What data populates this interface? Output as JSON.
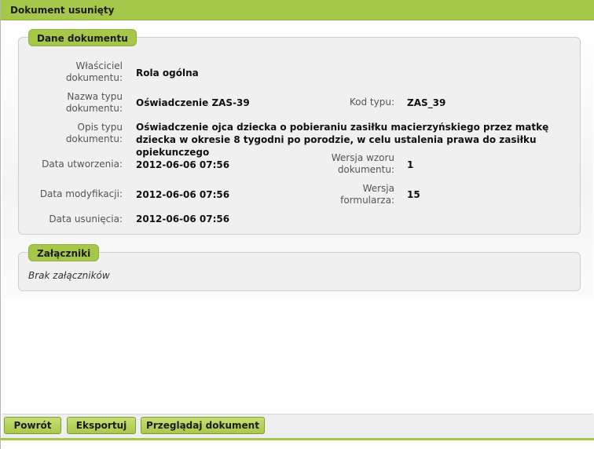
{
  "window": {
    "title": "Dokument usunięty"
  },
  "document_section": {
    "legend": "Dane dokumentu",
    "fields": {
      "owner_label": "Właściciel dokumentu:",
      "owner_value": "Rola ogólna",
      "type_name_label": "Nazwa typu dokumentu:",
      "type_name_value": "Oświadczenie ZAS-39",
      "type_code_label": "Kod typu:",
      "type_code_value": "ZAS_39",
      "type_desc_label": "Opis typu dokumentu:",
      "type_desc_value": "Oświadczenie ojca dziecka o pobieraniu zasiłku macierzyńskiego przez matkę dziecka w okresie 8 tygodni po porodzie, w celu ustalenia prawa do zasiłku opiekunczego",
      "created_label": "Data utworzenia:",
      "created_value": "2012-06-06 07:56",
      "template_version_label": "Wersja wzoru dokumentu:",
      "template_version_value": "1",
      "modified_label": "Data modyfikacji:",
      "modified_value": "2012-06-06 07:56",
      "form_version_label": "Wersja formularza:",
      "form_version_value": "15",
      "deleted_label": "Data usunięcia:",
      "deleted_value": "2012-06-06 07:56"
    }
  },
  "attachments_section": {
    "legend": "Załączniki",
    "empty_text": "Brak załączników"
  },
  "footer": {
    "back_label": "Powrót",
    "export_label": "Eksportuj",
    "view_label": "Przeglądaj dokument"
  },
  "colors": {
    "accent": "#a5c84a",
    "accent_border": "#8fb038",
    "panel_bg": "#f0f0f0"
  }
}
